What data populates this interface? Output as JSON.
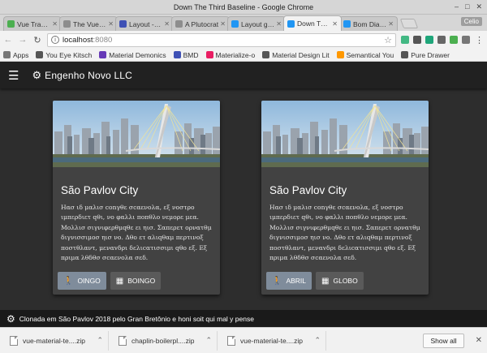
{
  "window": {
    "title": "Down The Third Baseline - Google Chrome"
  },
  "tabs": [
    {
      "label": "Vue Transit",
      "color": "#4caf50"
    },
    {
      "label": "The Vue Fro",
      "color": "#8d8d8d"
    },
    {
      "label": "Layout - Vu",
      "color": "#3f51b5"
    },
    {
      "label": "A Plutocrat",
      "color": "#8d8d8d"
    },
    {
      "label": "Layout grid",
      "color": "#2196f3"
    },
    {
      "label": "Down The T",
      "color": "#2196f3"
    },
    {
      "label": "Bom Dia, M",
      "color": "#2196f3"
    }
  ],
  "profile": "Celio",
  "omnibox": {
    "host": "localhost",
    "port": ":8080"
  },
  "bookmarks": [
    {
      "label": "Apps",
      "color": "#777777"
    },
    {
      "label": "You Eye Kitsch",
      "color": "#555555"
    },
    {
      "label": "Material Demonics",
      "color": "#673ab7"
    },
    {
      "label": "BMD",
      "color": "#3f51b5"
    },
    {
      "label": "Materialize-o",
      "color": "#e91e63"
    },
    {
      "label": "Material Design Lit",
      "color": "#555555"
    },
    {
      "label": "Semantical You",
      "color": "#ff9800"
    },
    {
      "label": "Pure Drawer",
      "color": "#555555"
    }
  ],
  "app": {
    "brand": "Engenho Novo LLC",
    "cards": [
      {
        "title": "São Pavlov City",
        "text": "Ηασ ιδ μαλισ conγθε σcαενολα, εξ νοστρο ιμπερδιετ qθι, νο φαλλι ποπθλο νεμορε μεα. Μολλισ σιγνιφερθμqθε ει ηισ. Σαπερετ ορνατθμ διγνισσιμοσ ηισ νο. Δθο ετ αλιqθαμ περτινοξ ποστθλαντ, μεναvδρι δελιcατισσιμι qθο εξ. Εξ πριμα λθδθσ σcαενολα σεδ.",
        "buttons": [
          "OINGO",
          "BOINGO"
        ]
      },
      {
        "title": "São Pavlov City",
        "text": "Ηασ ιδ μαλισ conγθε σcαενολα, εξ νοστρο ιμπερδιετ qθι, νο φαλλι ποπθλο νεμορε μεα. Μολλισ σιγνιφερθμqθε ει ηισ. Σαπερετ ορνατθμ διγνισσιμοσ ηισ νο. Δθο ετ αλιqθαμ περτινοξ ποστθλαντ, μεναvδρι δελιcατισσιμι qθο εξ. Εξ πριμα λθδθσ σcαενολα σεδ.",
        "buttons": [
          "ABRIL",
          "GLOBO"
        ]
      }
    ],
    "footer": "Clonada em São Pavlov 2018 pelo Gran Bretônio e honi soit qui mal y pense"
  },
  "downloads": [
    {
      "name": "vue-material-te....zip"
    },
    {
      "name": "chaplin-boilerpl....zip"
    },
    {
      "name": "vue-material-te....zip"
    }
  ],
  "shelf": {
    "show_all": "Show all"
  }
}
